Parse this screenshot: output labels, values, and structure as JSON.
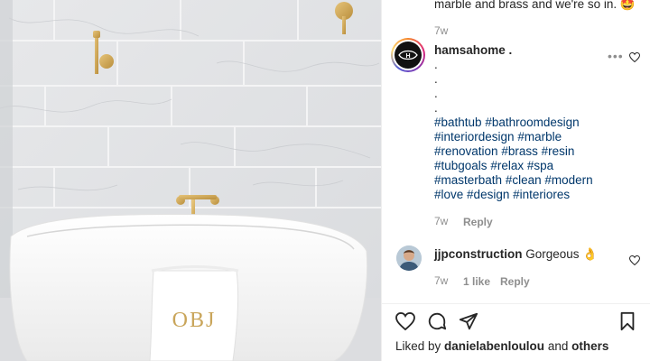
{
  "previous_comment": {
    "text_end": "marble and brass and we're so in. 🤩",
    "time": "7w"
  },
  "post": {
    "username": "hamsahome .",
    "dots": [
      ".",
      ".",
      ".",
      "."
    ],
    "hashtag_lines": [
      [
        "#bathtub",
        "#bathroomdesign"
      ],
      [
        "#interiordesign",
        "#marble"
      ],
      [
        "#renovation",
        "#brass",
        "#resin"
      ],
      [
        "#tubgoals",
        "#relax",
        "#spa"
      ],
      [
        "#masterbath",
        "#clean",
        "#modern"
      ],
      [
        "#love",
        "#design",
        "#interiores"
      ]
    ],
    "more_label": "•••",
    "time": "7w",
    "reply_label": "Reply"
  },
  "comment": {
    "username": "jjpconstruction",
    "text": "Gorgeous 👌",
    "time": "7w",
    "likes": "1 like",
    "reply_label": "Reply"
  },
  "actions": {
    "like_icon": "heart-icon",
    "comment_icon": "comment-icon",
    "share_icon": "paper-plane-icon",
    "save_icon": "bookmark-icon"
  },
  "liked_by": {
    "prefix": "Liked by ",
    "user": "danielabenloulou",
    "joiner": " and ",
    "others": "others"
  },
  "towel_monogram": "OBJ"
}
